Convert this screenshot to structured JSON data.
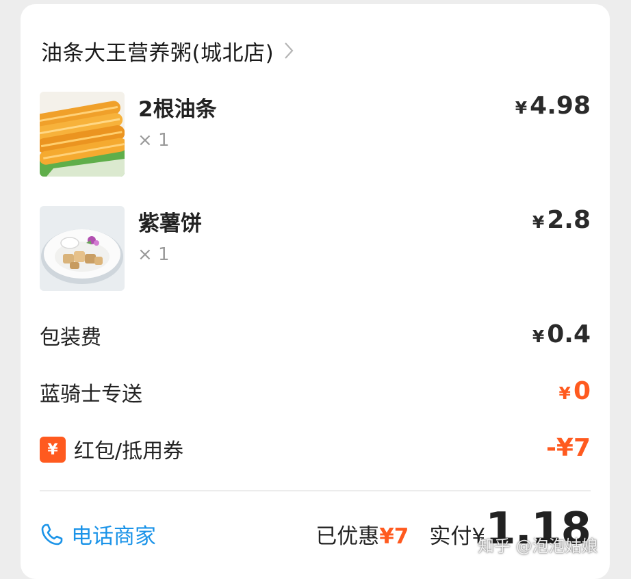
{
  "store": {
    "name": "油条大王营养粥(城北店)",
    "icon": "chevron-right-icon"
  },
  "items": [
    {
      "name": "2根油条",
      "qty": "× 1",
      "currency": "¥",
      "price": "4.98",
      "image": "fried-dough-sticks-photo"
    },
    {
      "name": "紫薯饼",
      "qty": "× 1",
      "currency": "¥",
      "price": "2.8",
      "image": "purple-potato-cake-photo"
    }
  ],
  "fees": {
    "packaging": {
      "label": "包装费",
      "currency": "¥",
      "amount": "0.4"
    },
    "delivery": {
      "label": "蓝骑士专送",
      "currency": "¥",
      "amount": "0"
    },
    "coupon": {
      "badge": "¥",
      "label": "红包/抵用券",
      "amount": "-¥7"
    }
  },
  "footer": {
    "call_label": "电话商家",
    "call_icon": "phone-icon",
    "discount_label": "已优惠",
    "discount_amount": "¥7",
    "paid_label": "实付",
    "paid_currency": "¥",
    "paid_amount": "1.18"
  },
  "watermark": "知乎 @泡泡姑娘",
  "colors": {
    "accent_orange": "#ff5a1f",
    "link_blue": "#1a93e8",
    "text": "#222222",
    "muted": "#9a9a9a"
  }
}
